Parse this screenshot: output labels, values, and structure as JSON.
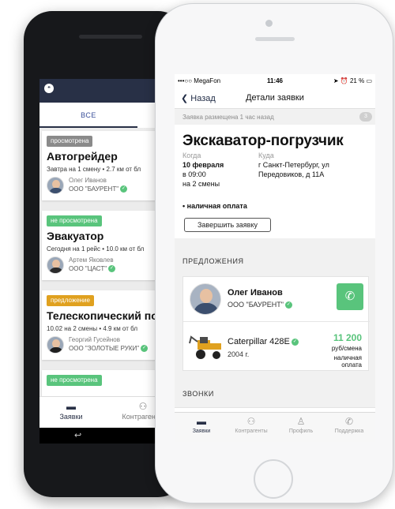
{
  "android": {
    "tab_all": "ВСЕ",
    "cards": [
      {
        "badge": "просмотрена",
        "badge_color": "#8a8a8a",
        "title": "Автогрейдер",
        "subtitle": "Завтра на 1 смену • 2.7 км от бл",
        "person": "Олег Иванов",
        "company": "ООО \"БАУРЕНТ\""
      },
      {
        "badge": "не просмотрена",
        "badge_color": "#59c47c",
        "title": "Эвакуатор",
        "subtitle": "Сегодня на 1 рейс • 10.0 км от бл",
        "person": "Артем Яковлев",
        "company": "ООО \"ЦАСТ\""
      },
      {
        "badge": "предложение",
        "badge_color": "#e0a11f",
        "title": "Телескопический погр",
        "subtitle": "10.02 на 2 смены • 4.9 км от бл",
        "person": "Георгий Гусейнов",
        "company": "ООО \"ЗОЛОТЫЕ РУКИ\""
      },
      {
        "badge": "не просмотрена",
        "badge_color": "#59c47c"
      }
    ],
    "nav": {
      "orders": "Заявки",
      "contractors": "Контрагенты"
    }
  },
  "iphone": {
    "status": {
      "carrier": "•••○○ MegaFon",
      "time": "11:46",
      "battery": "21 %"
    },
    "nav": {
      "back": "Назад",
      "title": "Детали заявки"
    },
    "posted": "Заявка размещена 1 час назад",
    "posted_badge": "3",
    "details": {
      "title": "Экскаватор-погрузчик",
      "when_label": "Когда",
      "when_lines": [
        "10 февраля",
        "в 09:00",
        "на 2 смены"
      ],
      "where_label": "Куда",
      "where_lines": [
        "г Санкт-Петербург, ул",
        "Передовиков, д 11А"
      ],
      "payment": "• наличная оплата",
      "finish_button": "Завершить заявку"
    },
    "offers_title": "ПРЕДЛОЖЕНИЯ",
    "offer": {
      "name": "Олег Иванов",
      "company": "ООО \"БАУРЕНТ\"",
      "machine": "Caterpillar 428E",
      "year": "2004 г.",
      "price": "11 200",
      "unit": "руб/смена",
      "payment": "наличная оплата"
    },
    "calls_title": "ЗВОНКИ",
    "tabs": [
      "Заявки",
      "Контрагенты",
      "Профиль",
      "Поддержка"
    ]
  },
  "colors": {
    "accent_dark": "#283046",
    "green": "#59c47c",
    "yellow": "#e0a11f"
  },
  "icons": [
    "logo-icon",
    "verified-icon",
    "chevron-left-icon",
    "chat-bubble-icon",
    "phone-icon",
    "briefcase-icon",
    "people-icon",
    "person-icon",
    "support-phone-icon"
  ]
}
